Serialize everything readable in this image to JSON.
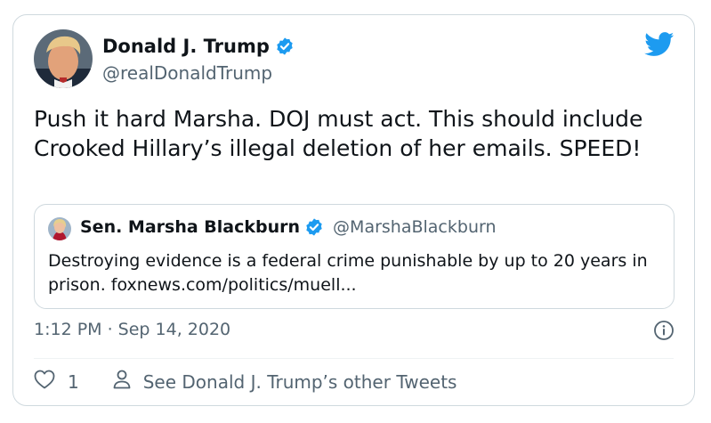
{
  "tweet": {
    "author": {
      "name": "Donald J. Trump",
      "handle": "@realDonaldTrump",
      "verified": true
    },
    "text": "Push it hard Marsha. DOJ must act. This should include Crooked Hillary’s illegal deletion of her emails. SPEED!",
    "quoted": {
      "name": "Sen. Marsha Blackburn",
      "handle": "@MarshaBlackburn",
      "verified": true,
      "text": "Destroying evidence is a federal crime punishable by up to 20 years in prison. foxnews.com/politics/muell..."
    },
    "timestamp": "1:12 PM · Sep 14, 2020",
    "likes": "1",
    "profile_link": "See Donald J. Trump’s other Tweets"
  },
  "icons": {
    "brand": "twitter-bird-icon",
    "verified": "verified-badge-icon",
    "info": "info-icon",
    "like": "heart-icon",
    "profile": "person-icon"
  },
  "colors": {
    "twitter_blue": "#1d9bf0",
    "text": "#0f1419",
    "secondary_text": "#536471",
    "border": "#cfd9de"
  }
}
